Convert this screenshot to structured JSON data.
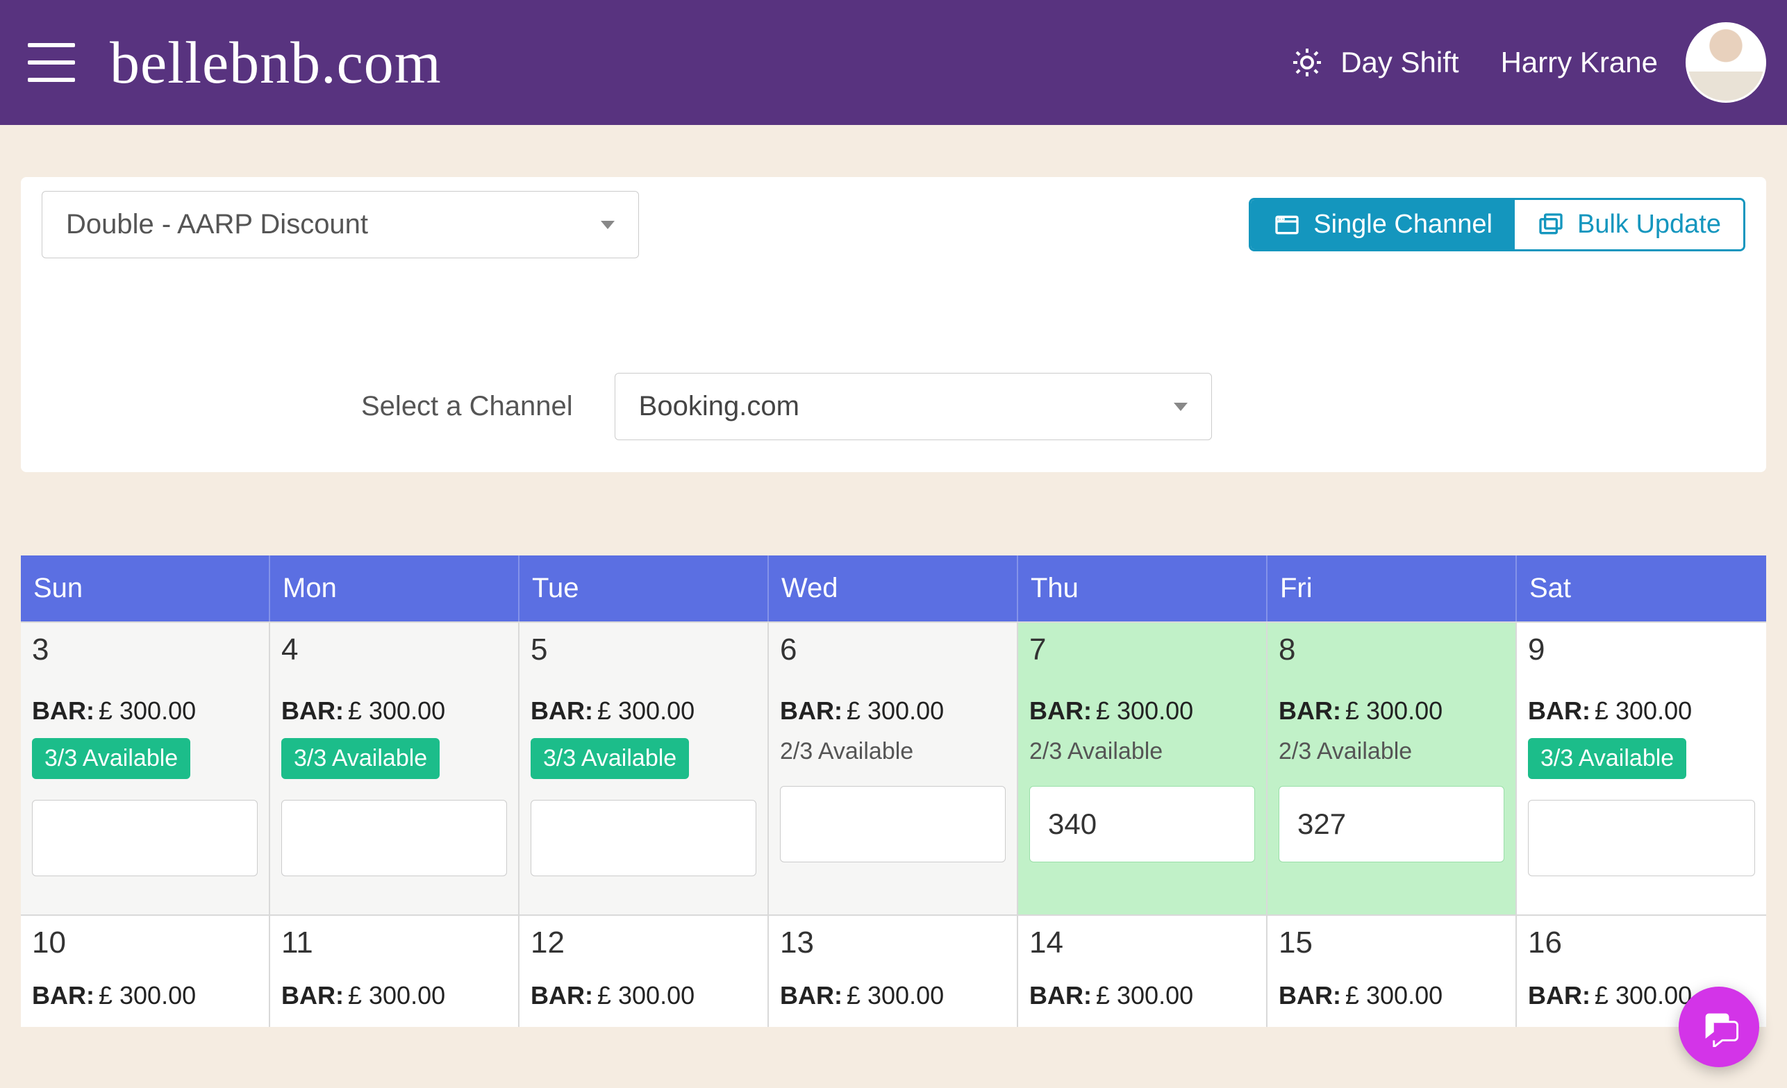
{
  "header": {
    "logo": "bellebnb.com",
    "shift_label": "Day Shift",
    "user_name": "Harry Krane"
  },
  "controls": {
    "rate_plan_selected": "Double - AARP Discount",
    "channel_label": "Select a Channel",
    "channel_selected": "Booking.com",
    "single_channel_label": "Single Channel",
    "bulk_update_label": "Bulk Update"
  },
  "calendar": {
    "weekdays": [
      "Sun",
      "Mon",
      "Tue",
      "Wed",
      "Thu",
      "Fri",
      "Sat"
    ],
    "bar_prefix": "BAR:",
    "rows": [
      [
        {
          "date": "3",
          "past": true,
          "price": "£ 300.00",
          "avail": "3/3 Available",
          "avail_full": true,
          "input_value": ""
        },
        {
          "date": "4",
          "past": true,
          "price": "£ 300.00",
          "avail": "3/3 Available",
          "avail_full": true,
          "input_value": ""
        },
        {
          "date": "5",
          "past": true,
          "price": "£ 300.00",
          "avail": "3/3 Available",
          "avail_full": true,
          "input_value": ""
        },
        {
          "date": "6",
          "past": true,
          "price": "£ 300.00",
          "avail": "2/3 Available",
          "avail_full": false,
          "input_value": ""
        },
        {
          "date": "7",
          "highlight": true,
          "price": "£ 300.00",
          "avail": "2/3 Available",
          "avail_full": false,
          "input_value": "340"
        },
        {
          "date": "8",
          "highlight": true,
          "price": "£ 300.00",
          "avail": "2/3 Available",
          "avail_full": false,
          "input_value": "327"
        },
        {
          "date": "9",
          "price": "£ 300.00",
          "avail": "3/3 Available",
          "avail_full": true,
          "input_value": ""
        }
      ],
      [
        {
          "date": "10",
          "price": "£ 300.00"
        },
        {
          "date": "11",
          "price": "£ 300.00"
        },
        {
          "date": "12",
          "price": "£ 300.00"
        },
        {
          "date": "13",
          "price": "£ 300.00"
        },
        {
          "date": "14",
          "price": "£ 300.00"
        },
        {
          "date": "15",
          "price": "£ 300.00"
        },
        {
          "date": "16",
          "price": "£ 300.00"
        }
      ]
    ]
  }
}
